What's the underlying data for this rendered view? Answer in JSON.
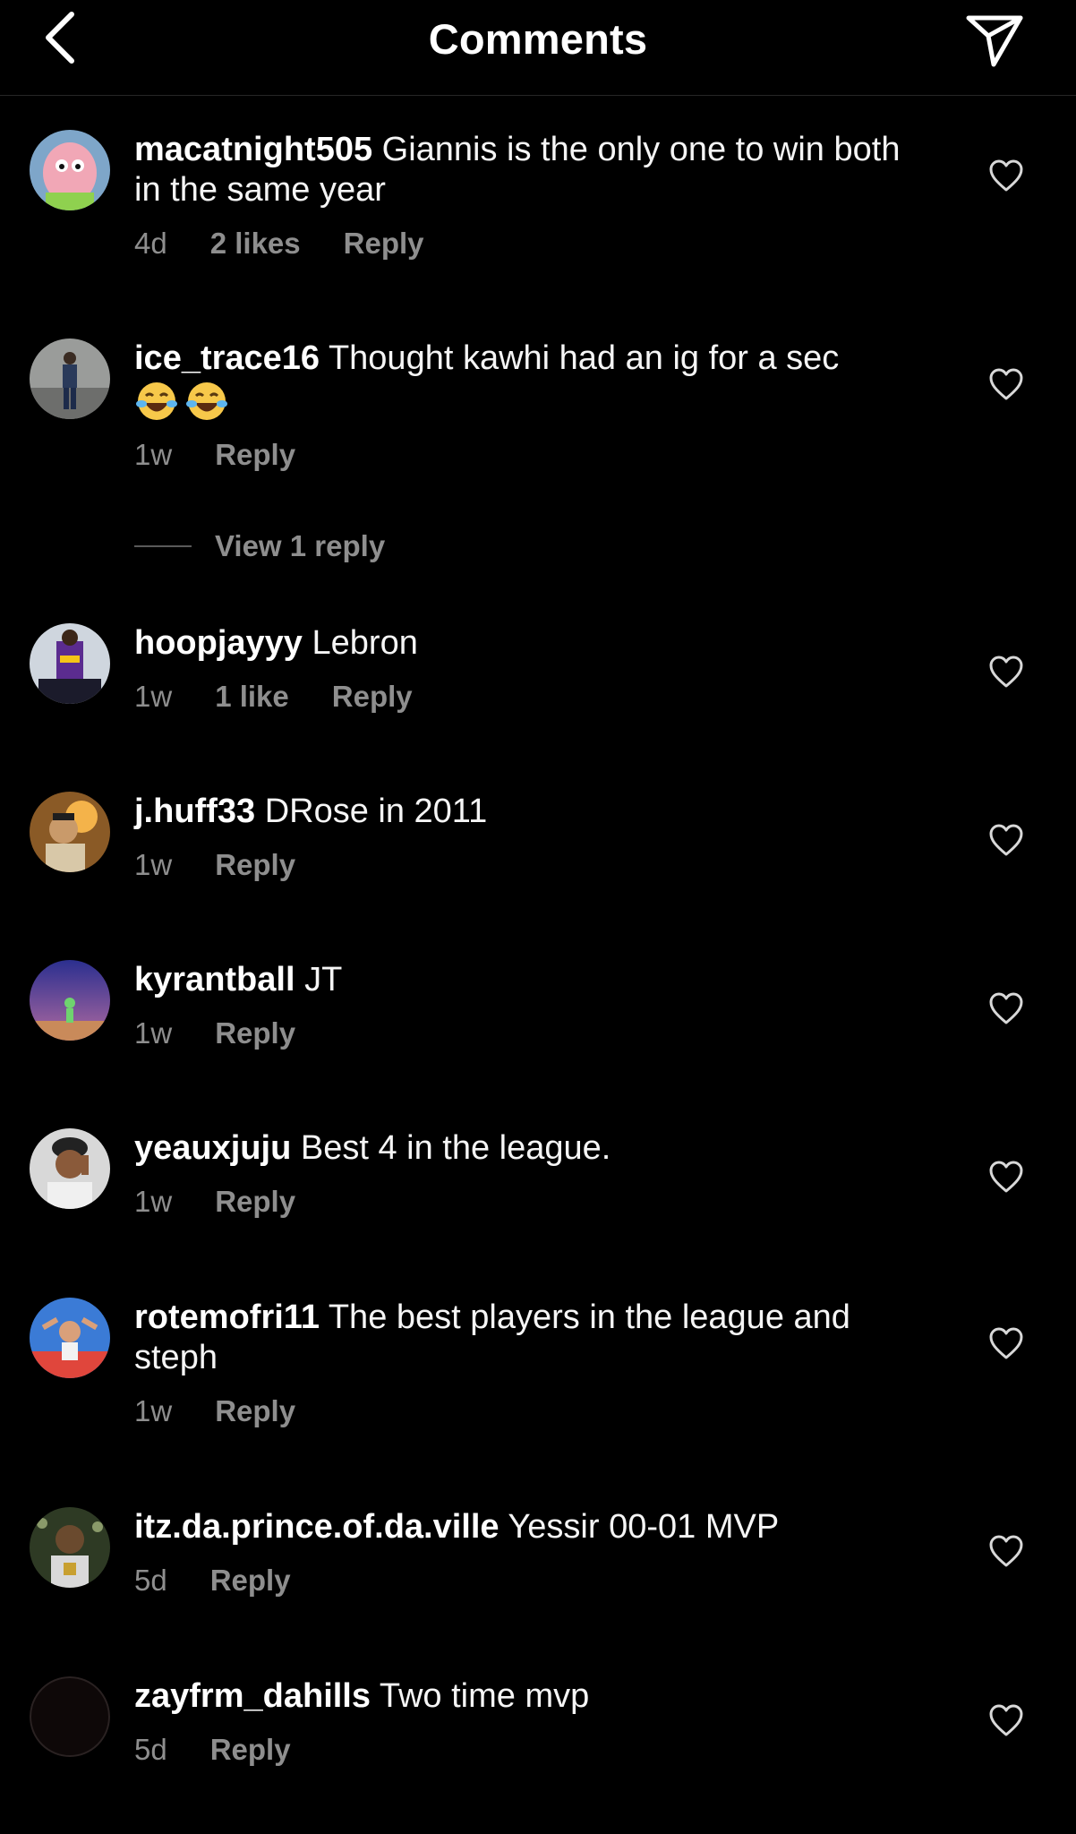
{
  "header": {
    "title": "Comments",
    "back_icon": "chevron-left-icon",
    "send_icon": "paper-plane-icon"
  },
  "comments": [
    {
      "username": "macatnight505",
      "text": "Giannis is the only one to win both in the same year",
      "time": "4d",
      "likes": "2 likes",
      "reply": "Reply"
    },
    {
      "username": "ice_trace16",
      "text": "Thought kawhi had an ig for a sec",
      "emoji": [
        "😂",
        "😂"
      ],
      "time": "1w",
      "reply": "Reply",
      "view_replies": "View 1 reply"
    },
    {
      "username": "hoopjayyy",
      "text": "Lebron",
      "time": "1w",
      "likes": "1 like",
      "reply": "Reply"
    },
    {
      "username": "j.huff33",
      "text": "DRose in 2011",
      "time": "1w",
      "reply": "Reply"
    },
    {
      "username": "kyrantball",
      "text": "JT",
      "time": "1w",
      "reply": "Reply"
    },
    {
      "username": "yeauxjuju",
      "text": "Best 4 in the league.",
      "time": "1w",
      "reply": "Reply"
    },
    {
      "username": "rotemofri11",
      "text": "The best players in the league and steph",
      "time": "1w",
      "reply": "Reply"
    },
    {
      "username": "itz.da.prince.of.da.ville",
      "text": "Yessir 00-01 MVP",
      "time": "5d",
      "reply": "Reply"
    },
    {
      "username": "zayfrm_dahills",
      "text": "Two time mvp",
      "time": "5d",
      "reply": "Reply"
    }
  ],
  "colors": {
    "background": "#000000",
    "text": "#f5f5f5",
    "secondary": "#8e8e8e",
    "divider": "#262626"
  }
}
